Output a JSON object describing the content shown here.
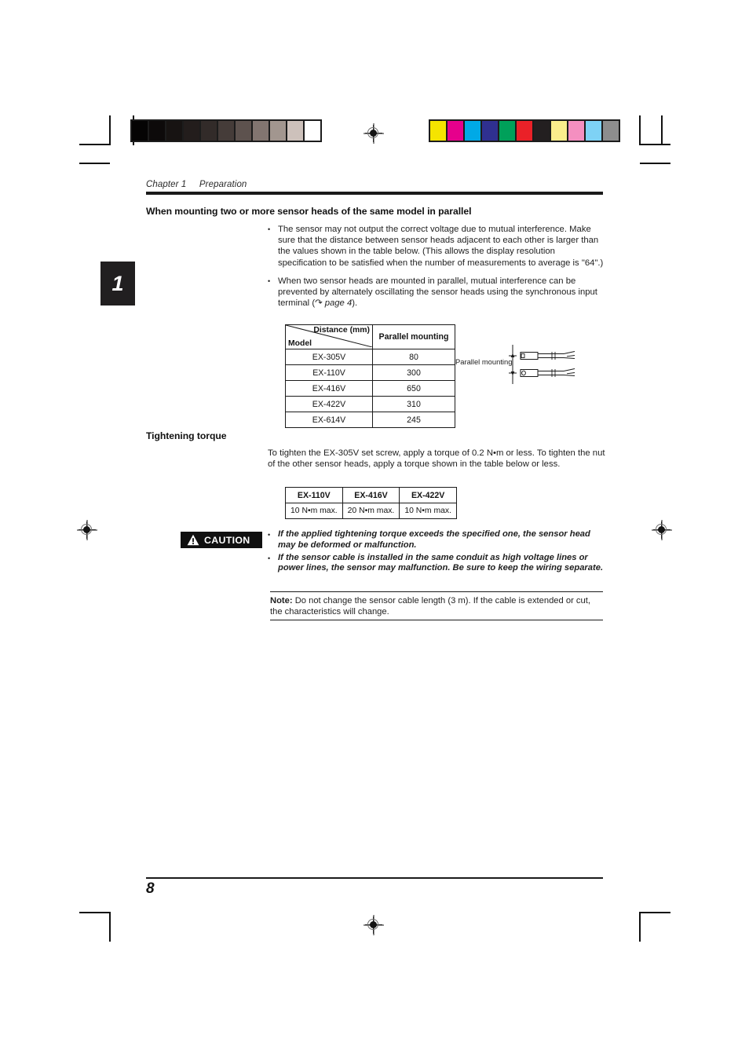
{
  "header": {
    "chapter_line": "Chapter 1     Preparation",
    "chapter_tab_number": "1"
  },
  "sections": {
    "parallel_mounting": {
      "title": "When mounting two or more sensor heads of the same model in parallel",
      "bullets": [
        {
          "marker": "•",
          "text_before": "The sensor may not output the correct voltage due to mutual interference. Make sure that the distance between sensor heads adjacent to each other is larger than the values shown in the table below. (This allows the display resolution specification to be satisfied when the number of measurements to average is \"64\".)",
          "italic": "",
          "text_after": ""
        },
        {
          "marker": "•",
          "text_before": "When two sensor heads are mounted in parallel, mutual interference can be prevented by alternately oscillating the sensor heads using the synchronous input terminal (↷ ",
          "italic": "page 4",
          "text_after": ")."
        }
      ]
    },
    "tightening_torque": {
      "title": "Tightening torque",
      "paragraph": "To tighten the EX-305V set screw, apply a torque of 0.2 N•m or less. To tighten the nut of the other sensor heads, apply a torque shown in the table below or less."
    }
  },
  "distance_table": {
    "header_diagonal_top_right": "Distance (mm)",
    "header_diagonal_bottom_left": "Model",
    "header_column_2": "Parallel mounting",
    "rows": [
      {
        "model": "EX-305V",
        "parallel_mounting": "80"
      },
      {
        "model": "EX-110V",
        "parallel_mounting": "300"
      },
      {
        "model": "EX-416V",
        "parallel_mounting": "650"
      },
      {
        "model": "EX-422V",
        "parallel_mounting": "310"
      },
      {
        "model": "EX-614V",
        "parallel_mounting": "245"
      }
    ]
  },
  "parallel_figure": {
    "label": "Parallel mounting"
  },
  "torque_table": {
    "headers": [
      "EX-110V",
      "EX-416V",
      "EX-422V"
    ],
    "values": [
      "10 N•m max.",
      "20 N•m max.",
      "10 N•m max."
    ]
  },
  "caution": {
    "badge_label": "CAUTION",
    "icon": "warning-triangle-icon",
    "bullets": [
      {
        "marker": "•",
        "text": "If the applied tightening torque exceeds the specified one, the sensor head may be deformed or malfunction."
      },
      {
        "marker": "•",
        "text": "If the sensor cable is installed in the same conduit as high voltage lines or power lines, the sensor may malfunction. Be sure to keep the wiring separate."
      }
    ]
  },
  "note": {
    "label": "Note:",
    "text": " Do not change the sensor cable length (3 m). If the cable is extended or cut, the characteristics will change."
  },
  "footer": {
    "page_number": "8"
  },
  "calibration": {
    "grayscale_swatches": [
      "#050404",
      "#0d0a0a",
      "#171312",
      "#231d1c",
      "#322b29",
      "#453c39",
      "#5d524e",
      "#827570",
      "#a2968f",
      "#cdc1bb",
      "#ffffff"
    ],
    "color_swatches": [
      "#f5e400",
      "#e6008c",
      "#00a9e6",
      "#2f3090",
      "#00a05a",
      "#ea2128",
      "#231f20",
      "#faed8c",
      "#f48fc0",
      "#7ed2f5",
      "#8d8d8d"
    ]
  }
}
